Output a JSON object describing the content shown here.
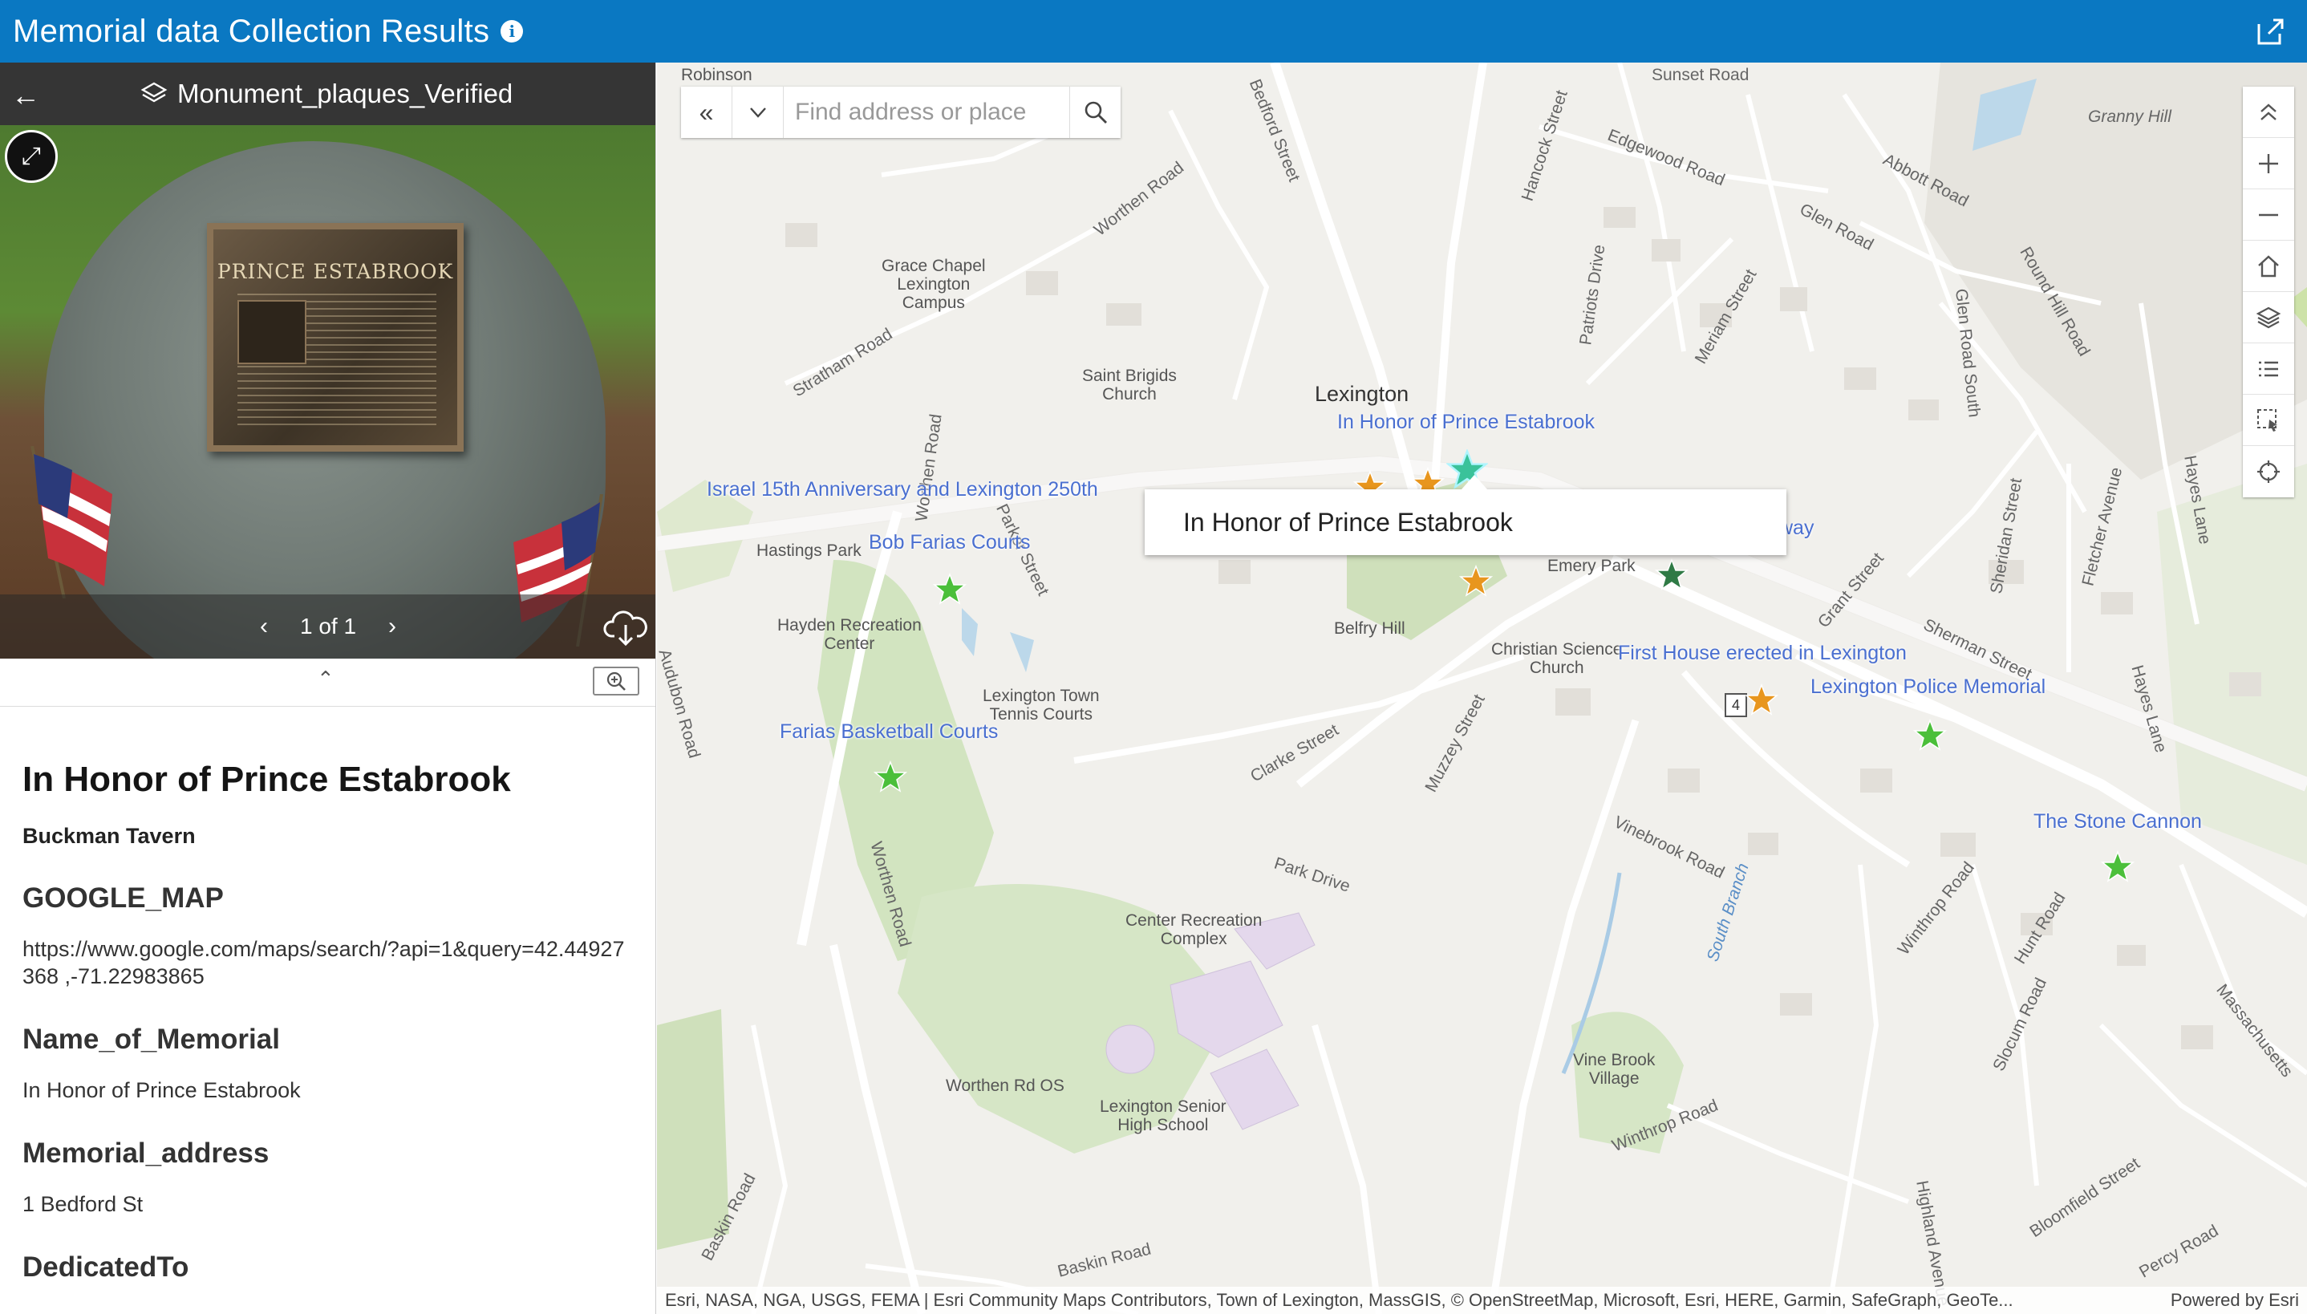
{
  "app": {
    "title": "Memorial data Collection Results"
  },
  "panel": {
    "layer_name": "Monument_plaques_Verified",
    "photo": {
      "plaque_title": "PRINCE ESTABROOK",
      "pager": "1 of 1"
    },
    "feature": {
      "title": "In Honor of Prince Estabrook",
      "subtitle": "Buckman Tavern",
      "fields": [
        {
          "label": "GOOGLE_MAP",
          "value": "https://www.google.com/maps/search/?api=1&query=42.44927368 ,-71.22983865"
        },
        {
          "label": "Name_of_Memorial",
          "value": "In Honor of Prince Estabrook"
        },
        {
          "label": "Memorial_address",
          "value": "1 Bedford St"
        },
        {
          "label": "DedicatedTo",
          "value": ""
        }
      ]
    }
  },
  "map": {
    "search": {
      "placeholder": "Find address or place"
    },
    "popup_title": "In Honor of Prince Estabrook",
    "town": "Lexington",
    "poi_labels": {
      "prince": "In Honor of Prince Estabrook",
      "israel": "Israel 15th Anniversary and Lexington 250th",
      "bob": "Bob Farias Courts",
      "farias": "Farias Basketball Courts",
      "first_house": "First House erected in Lexington",
      "police": "Lexington Police Memorial",
      "stone_cannon": "The Stone Cannon",
      "way_fragment": "way"
    },
    "place_labels": {
      "robinson": "Robinson",
      "robinson2": "Hill",
      "granny": "Granny Hill",
      "grace": "Grace Chapel\nLexington\nCampus",
      "saint": "Saint Brigids\nChurch",
      "hastings": "Hastings Park",
      "hayden": "Hayden Recreation\nCenter",
      "tennis": "Lexington Town\nTennis Courts",
      "emery": "Emery Park",
      "belfry": "Belfry Hill",
      "christian": "Christian Science\nChurch",
      "center_rec": "Center Recreation\nComplex",
      "worthen_os": "Worthen Rd OS",
      "high_school": "Lexington Senior\nHigh School",
      "vine_brook": "Vine Brook\nVillage"
    },
    "streets": {
      "bedford": "Bedford Street",
      "worthen1": "Worthen Road",
      "worthen2": "Worthen Road",
      "worthen3": "Worthen Road",
      "hancock": "Hancock Street",
      "edgewood": "Edgewood Road",
      "abbott": "Abbott Road",
      "glen": "Glen Road",
      "round_hill": "Round Hill Road",
      "patriots": "Patriots Drive",
      "meriam": "Meriam Street",
      "stratham": "Stratham Road",
      "parker": "Parker Street",
      "clarke": "Clarke Street",
      "muzzey": "Muzzey Street",
      "vinebrook": "Vinebrook Road",
      "park": "Park Drive",
      "grant": "Grant Street",
      "sherman": "Sherman Street",
      "sheridan": "Sheridan Street",
      "fletcher": "Fletcher Avenue",
      "hayes_lane": "Hayes Lane",
      "hayes_lane2": "Hayes Lane",
      "winthrop": "Winthrop Road",
      "winthrop2": "Winthrop Road",
      "hunt": "Hunt Road",
      "slocum": "Slocum Road",
      "bloomfield": "Bloomfield Street",
      "highland": "Highland Avenue",
      "percy": "Percy Road",
      "baskin": "Baskin Road",
      "baskin2": "Baskin Road",
      "mass": "Massachusetts",
      "south_branch": "South Branch",
      "glen_south": "Glen Road South",
      "audubon": "Audubon Road",
      "sunset": "Sunset Road"
    },
    "route_number": "4",
    "attribution": "Esri, NASA, NGA, USGS, FEMA | Esri Community Maps Contributors, Town of Lexington, MassGIS, © OpenStreetMap, Microsoft, Esri, HERE, Garmin, SafeGraph, GeoTe...",
    "powered_by": "Powered by Esri"
  },
  "colors": {
    "topbar": "#0a78c2",
    "panel_header": "#353535",
    "star_green": "#4bbf3a",
    "star_orange": "#e8961e",
    "star_dark_green": "#2f7a45",
    "poi_text": "#4a6fd0"
  }
}
